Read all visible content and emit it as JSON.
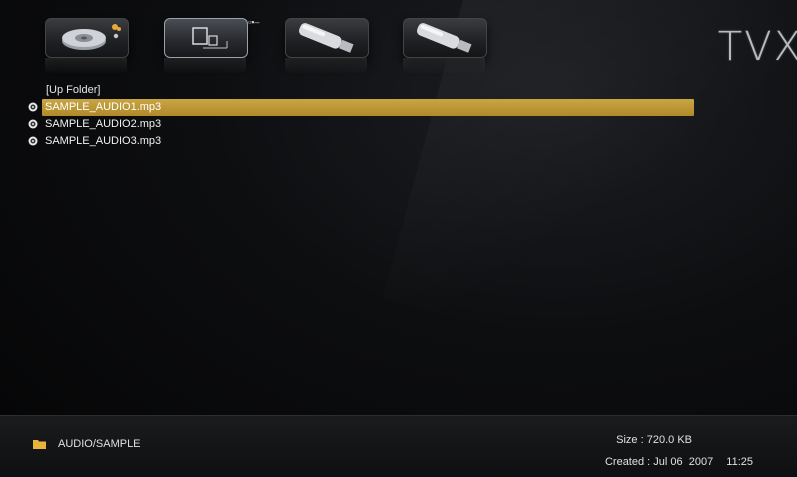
{
  "brand": "TVX",
  "devices": [
    {
      "name": "hdd",
      "icon": "hard-drive-icon",
      "selected": false
    },
    {
      "name": "network",
      "icon": "network-pc-icon",
      "selected": true
    },
    {
      "name": "usb1",
      "icon": "usb-drive-icon",
      "selected": false
    },
    {
      "name": "usb2",
      "icon": "usb-drive-icon",
      "selected": false
    }
  ],
  "list": {
    "up_folder": "[Up Folder]",
    "items": [
      {
        "name": "SAMPLE_AUDIO1.mp3",
        "icon": "audio-disc-icon",
        "selected": true
      },
      {
        "name": "SAMPLE_AUDIO2.mp3",
        "icon": "audio-disc-icon",
        "selected": false
      },
      {
        "name": "SAMPLE_AUDIO3.mp3",
        "icon": "audio-disc-icon",
        "selected": false
      }
    ]
  },
  "status": {
    "path": "AUDIO/SAMPLE",
    "size_label": "Size",
    "size_value": "720.0 KB",
    "created_label": "Created",
    "created_date": "Jul 06  2007",
    "created_time": "11:25"
  },
  "colors": {
    "highlight": "#c9a543",
    "background": "#0d0e10",
    "text": "#f2f2f2"
  }
}
